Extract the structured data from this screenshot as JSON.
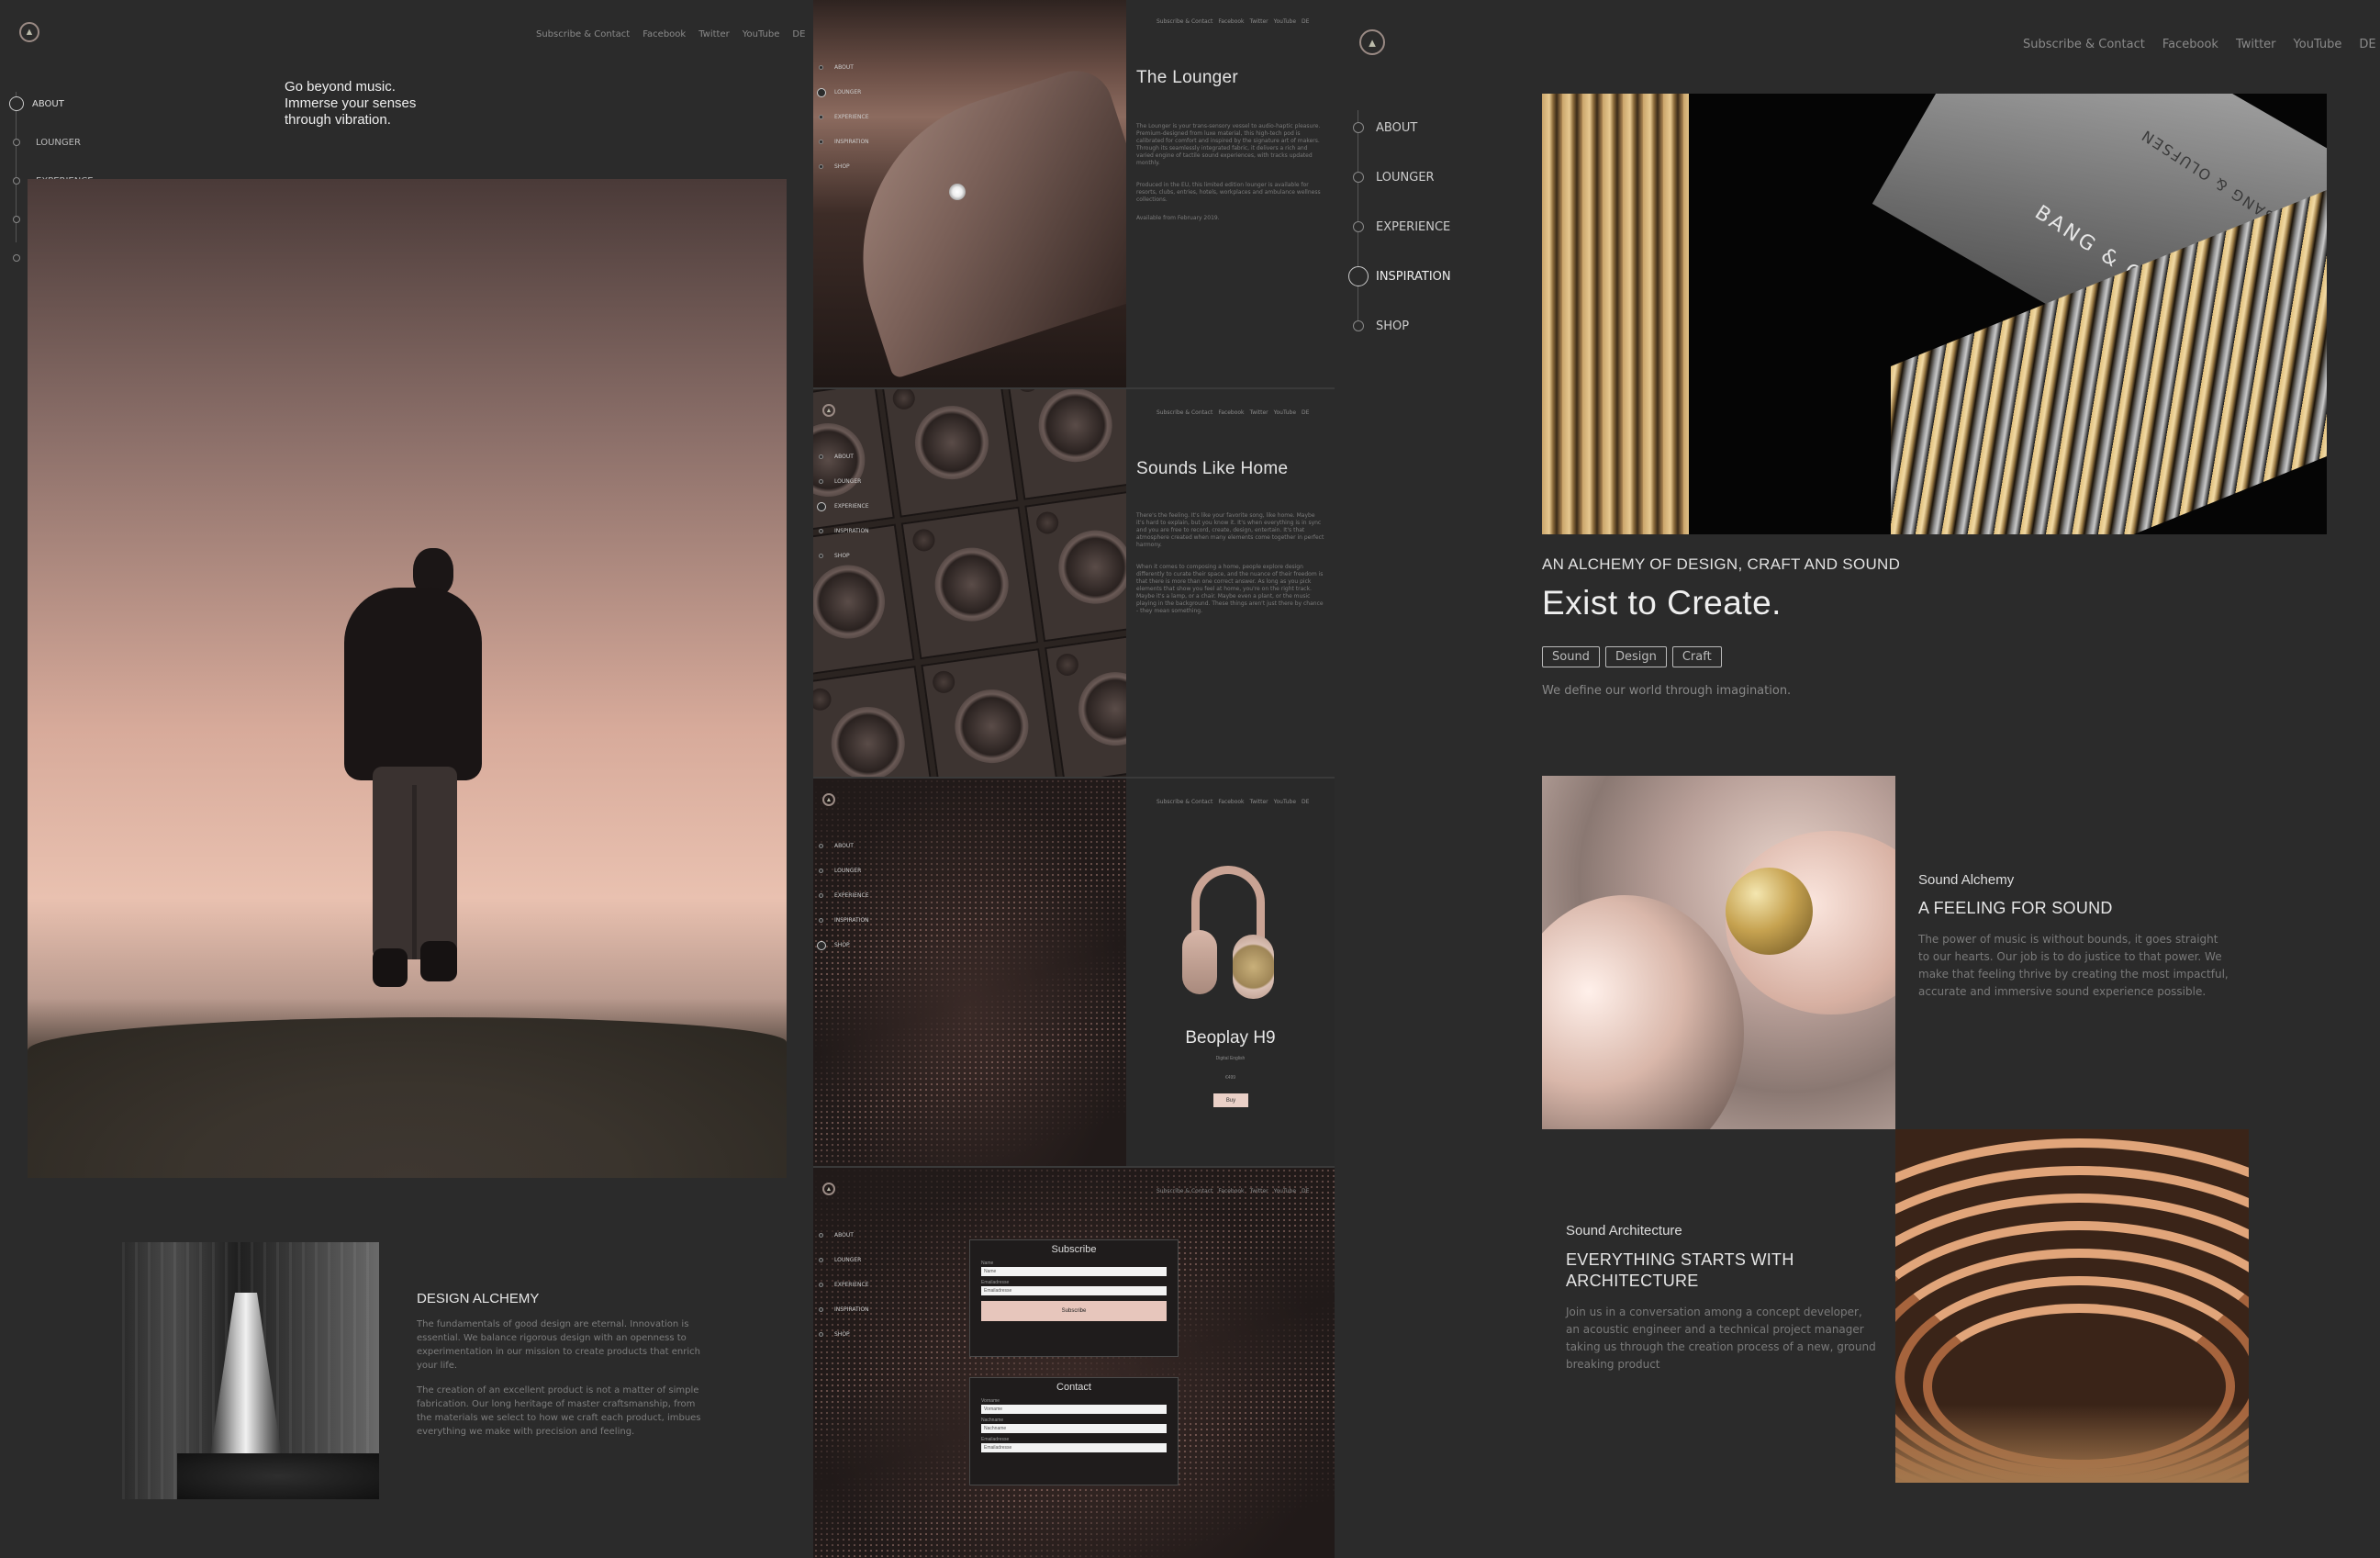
{
  "top_links": [
    "Subscribe & Contact",
    "Facebook",
    "Twitter",
    "YouTube",
    "DE"
  ],
  "nav_items": [
    "ABOUT",
    "LOUNGER",
    "EXPERIENCE",
    "INSPIRATION",
    "SHOP"
  ],
  "panel1": {
    "tagline_1": "Go beyond music.",
    "tagline_2": "Immerse your senses",
    "tagline_3": "through vibration.",
    "design_heading": "DESIGN ALCHEMY",
    "design_p1": "The fundamentals of good design are eternal. Innovation is essential. We balance rigorous design with an openness to experimentation in our mission to create products that enrich your life.",
    "design_p2": "The creation of an excellent product is not a matter of simple fabrication. Our long heritage of master craftsmanship, from the materials we select to how we craft each product, imbues everything we make with precision and feeling."
  },
  "panel2": {
    "lounger_title": "The Lounger",
    "lounger_text_1": "The Lounger is your trans-sensory vessel to audio-haptic pleasure. Premium-designed from luxe material, this high-tech pod is calibrated for comfort and inspired by the signature art of makers. Through its seamlessly integrated fabric, it delivers a rich and varied engine of tactile sound experiences, with tracks updated monthly.",
    "lounger_text_2": "Produced in the EU, this limited edition lounger is available for resorts, clubs, entries, hotels, workplaces and ambulance wellness collections.",
    "lounger_text_3": "Available from February 2019.",
    "home_title": "Sounds Like Home",
    "home_text_1": "There's the feeling. It's like your favorite song, like home. Maybe it's hard to explain, but you know it. It's when everything is in sync and you are free to record, create, design, entertain. It's that atmosphere created when many elements come together in perfect harmony.",
    "home_text_2": "When it comes to composing a home, people explore design differently to curate their space, and the nuance of their freedom is that there is more than one correct answer. As long as you pick elements that show you feel at home, you're on the right track. Maybe it's a lamp, or a chair. Maybe even a plant, or the music playing in the background. These things aren't just there by chance - they mean something.",
    "product_name": "Beoplay H9",
    "product_sub": "Digital English",
    "product_price": "€499",
    "buy_label": "Buy",
    "subscribe_title": "Subscribe",
    "subscribe_name_label": "Name",
    "subscribe_name_value": "Name",
    "subscribe_email_label": "Emailadresse",
    "subscribe_email_value": "Emailadresse",
    "subscribe_button": "Subscribe",
    "contact_title": "Contact",
    "contact_f1_label": "Vorname",
    "contact_f1_value": "Vorname",
    "contact_f2_label": "Nachname",
    "contact_f2_value": "Nachname",
    "contact_f3_label": "Emailadresse",
    "contact_f3_value": "Emailadresse"
  },
  "panel3": {
    "speaker_brand": "BANG & OLUFSEN",
    "speaker_brand_back": "BANG & OLUFSEN",
    "kicker": "AN ALCHEMY OF DESIGN, CRAFT AND SOUND",
    "headline": "Exist to Create.",
    "tags": [
      "Sound",
      "Design",
      "Craft"
    ],
    "subline": "We define our world through imagination.",
    "alchemy_kicker": "Sound Alchemy",
    "alchemy_heading": "A FEELING FOR SOUND",
    "alchemy_text": "The power of music is without bounds, it goes straight to our hearts. Our job is to do justice to that power. We make that feeling thrive by creating the most impactful, accurate and immersive sound experience possible.",
    "arch_kicker": "Sound Architecture",
    "arch_heading_1": "EVERYTHING STARTS WITH",
    "arch_heading_2": "ARCHITECTURE",
    "arch_text": "Join us in a conversation among a concept developer, an acoustic engineer and a technical project manager taking us through the creation process of a new, ground breaking product"
  }
}
